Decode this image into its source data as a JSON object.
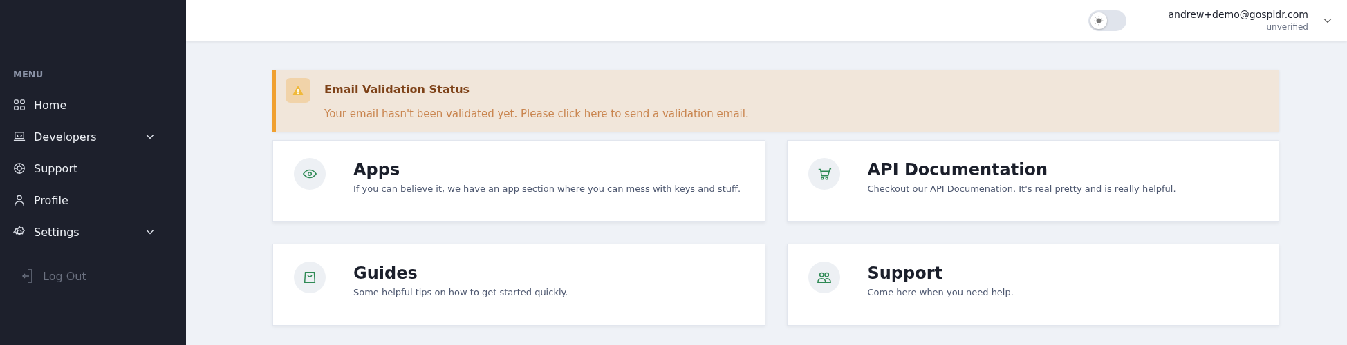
{
  "sidebar": {
    "heading": "MENU",
    "items": [
      {
        "label": "Home",
        "expandable": false
      },
      {
        "label": "Developers",
        "expandable": true
      },
      {
        "label": "Support",
        "expandable": false
      },
      {
        "label": "Profile",
        "expandable": false
      },
      {
        "label": "Settings",
        "expandable": true
      }
    ],
    "logout": "Log Out"
  },
  "header": {
    "theme_toggle": {
      "on": false
    },
    "user": {
      "email": "andrew+demo@gospidr.com",
      "status": "unverified"
    }
  },
  "alert": {
    "title": "Email Validation Status",
    "message": "Your email hasn't been validated yet. Please click here to send a validation email."
  },
  "cards": [
    {
      "title": "Apps",
      "description": "If you can believe it, we have an app section where you can mess with keys and stuff."
    },
    {
      "title": "API Documentation",
      "description": "Checkout our API Documenation. It's real pretty and is really helpful."
    },
    {
      "title": "Guides",
      "description": "Some helpful tips on how to get started quickly."
    },
    {
      "title": "Support",
      "description": "Come here when you need help."
    }
  ]
}
